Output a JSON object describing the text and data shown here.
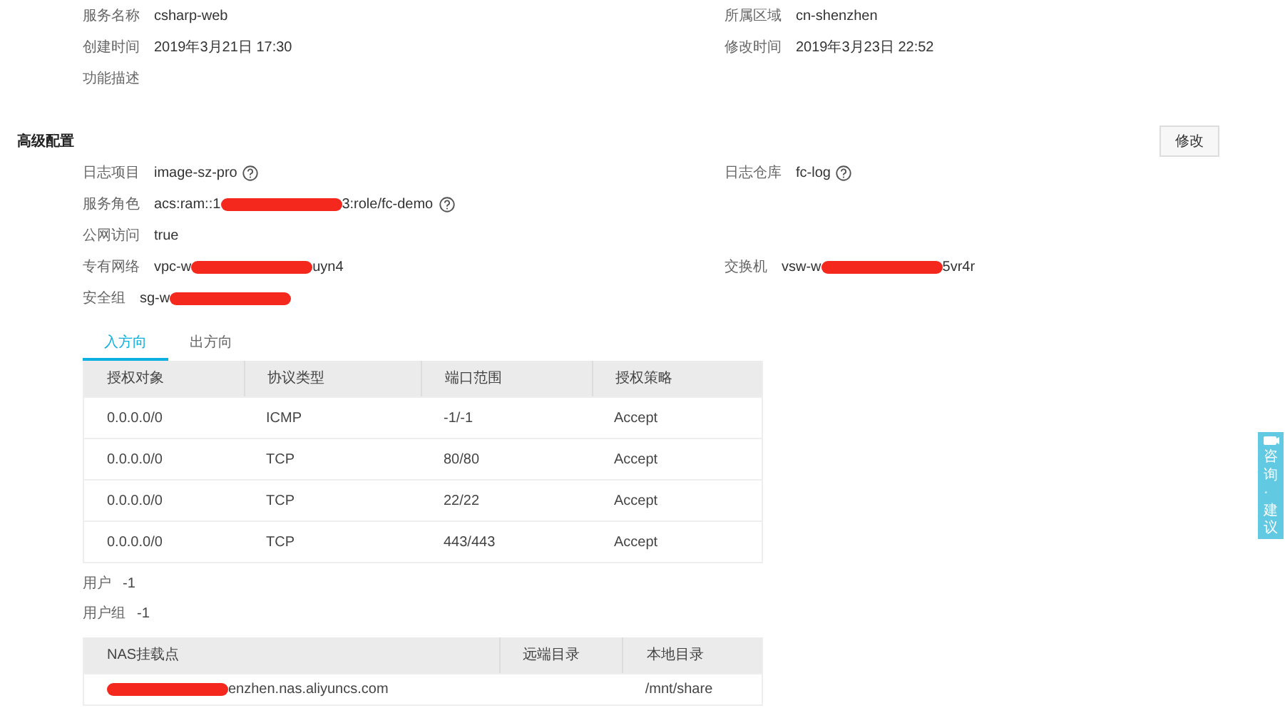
{
  "basic": [
    [
      {
        "label": "服务名称",
        "segments": [
          {
            "kind": "text",
            "text": "csharp-web"
          }
        ]
      },
      {
        "label": "所属区域",
        "segments": [
          {
            "kind": "text",
            "text": "cn-shenzhen"
          }
        ]
      }
    ],
    [
      {
        "label": "创建时间",
        "segments": [
          {
            "kind": "text",
            "text": "2019年3月21日 17:30"
          }
        ]
      },
      {
        "label": "修改时间",
        "segments": [
          {
            "kind": "text",
            "text": "2019年3月23日 22:52"
          }
        ]
      }
    ],
    [
      {
        "label": "功能描述"
      }
    ]
  ],
  "advanced": {
    "title": "高级配置",
    "button": "修改",
    "rows": [
      [
        {
          "label": "日志项目",
          "segments": [
            {
              "kind": "text",
              "text": "image-sz-pro"
            }
          ],
          "help": true
        },
        {
          "label": "日志仓库",
          "segments": [
            {
              "kind": "text",
              "text": "fc-log"
            }
          ],
          "help": true
        }
      ],
      [
        {
          "label": "服务角色",
          "segments": [
            {
              "kind": "text",
              "text": "acs:ram::1"
            },
            {
              "kind": "redaction"
            },
            {
              "kind": "text",
              "text": "3:role/fc-demo"
            }
          ],
          "help": true
        }
      ],
      [
        {
          "label": "公网访问",
          "segments": [
            {
              "kind": "text",
              "text": "true"
            }
          ]
        }
      ],
      [
        {
          "label": "专有网络",
          "segments": [
            {
              "kind": "text",
              "text": "vpc-w"
            },
            {
              "kind": "redaction"
            },
            {
              "kind": "text",
              "text": "uyn4"
            }
          ]
        },
        {
          "label": "交换机",
          "segments": [
            {
              "kind": "text",
              "text": "vsw-w"
            },
            {
              "kind": "redaction"
            },
            {
              "kind": "text",
              "text": "5vr4r"
            }
          ]
        }
      ],
      [
        {
          "label": "安全组",
          "segments": [
            {
              "kind": "text",
              "text": "sg-w"
            },
            {
              "kind": "redaction"
            }
          ]
        }
      ]
    ]
  },
  "tabs": [
    {
      "label": "入方向",
      "selected": true
    },
    {
      "label": "出方向",
      "selected": false
    }
  ],
  "rules_table": {
    "columns": [
      "授权对象",
      "协议类型",
      "端口范围",
      "授权策略"
    ],
    "rows": [
      [
        "0.0.0.0/0",
        "ICMP",
        "-1/-1",
        "Accept"
      ],
      [
        "0.0.0.0/0",
        "TCP",
        "80/80",
        "Accept"
      ],
      [
        "0.0.0.0/0",
        "TCP",
        "22/22",
        "Accept"
      ],
      [
        "0.0.0.0/0",
        "TCP",
        "443/443",
        "Accept"
      ]
    ]
  },
  "user": {
    "label": "用户",
    "value": "-1"
  },
  "user_group": {
    "label": "用户组",
    "value": "-1"
  },
  "nas_table": {
    "columns": [
      "NAS挂载点",
      "远端目录",
      "本地目录"
    ],
    "rows": [
      [
        {
          "segments": [
            {
              "kind": "redaction"
            },
            {
              "kind": "text",
              "text": "enzhen.nas.aliyuncs.com"
            }
          ]
        },
        {},
        {
          "segments": [
            {
              "kind": "text",
              "text": "/mnt/share"
            }
          ]
        }
      ]
    ]
  },
  "consult": {
    "label": "咨询·建议"
  }
}
